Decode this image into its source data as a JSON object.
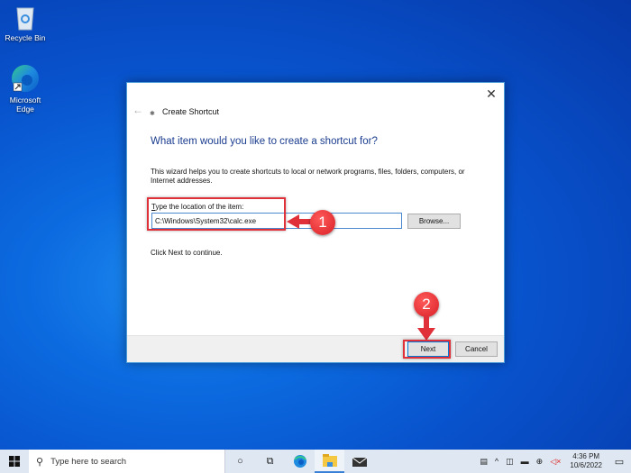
{
  "desktop": {
    "icons": [
      {
        "label": "Recycle Bin",
        "icon": "recycle-bin-icon"
      },
      {
        "label": "Microsoft Edge",
        "icon": "edge-icon"
      }
    ]
  },
  "dialog": {
    "title": "Create Shortcut",
    "heading": "What item would you like to create a shortcut for?",
    "description": "This wizard helps you to create shortcuts to local or network programs, files, folders, computers, or Internet addresses.",
    "field_label_accel": "T",
    "field_label_rest": "ype the location of the item:",
    "location_value": "C:\\Windows\\System32\\calc.exe",
    "browse_label": "Browse...",
    "hint": "Click Next to continue.",
    "next_label": "Next",
    "cancel_label": "Cancel",
    "close_glyph": "✕",
    "back_glyph": "←"
  },
  "annotations": {
    "step1": "1",
    "step2": "2",
    "color": "#e0303a"
  },
  "taskbar": {
    "search_placeholder": "Type here to search",
    "time": "4:36 PM",
    "date": "10/6/2022"
  }
}
